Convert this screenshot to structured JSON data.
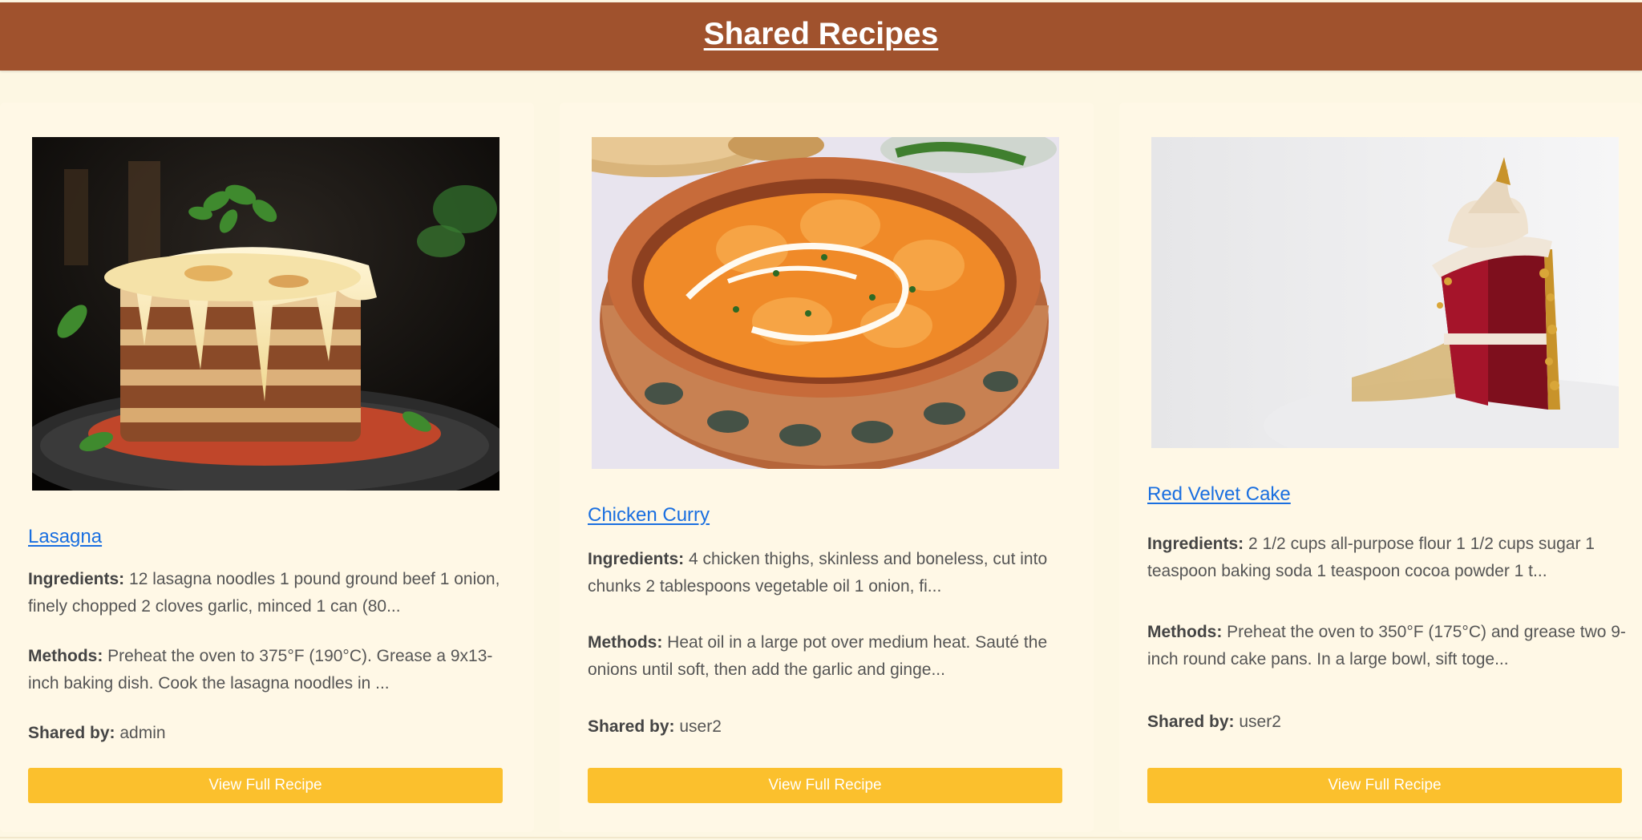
{
  "header": {
    "title": "Shared Recipes"
  },
  "colors": {
    "header_bg": "#a0522d",
    "page_bg": "#fdf7e3",
    "card_bg": "#fff8e6",
    "button_bg": "#fbc02d",
    "link": "#1a6fe0"
  },
  "labels": {
    "ingredients": "Ingredients:",
    "methods": "Methods:",
    "shared_by": "Shared by:"
  },
  "recipes": [
    {
      "title": "Lasagna",
      "image_alt": "Lasagna",
      "ingredients": "12 lasagna noodles 1 pound ground beef 1 onion, finely chopped 2 cloves garlic, minced 1 can (80...",
      "methods": "Preheat the oven to 375°F (190°C). Grease a 9x13-inch baking dish. Cook the lasagna noodles in ...",
      "shared_by": "admin",
      "button": "View Full Recipe"
    },
    {
      "title": "Chicken Curry",
      "image_alt": "Chicken Curry",
      "ingredients": "4 chicken thighs, skinless and boneless, cut into chunks 2 tablespoons vegetable oil 1 onion, fi...",
      "methods": "Heat oil in a large pot over medium heat. Sauté the onions until soft, then add the garlic and ginge...",
      "shared_by": "user2",
      "button": "View Full Recipe"
    },
    {
      "title": "Red Velvet Cake",
      "image_alt": "Red Velvet Cake",
      "ingredients": "2 1/2 cups all-purpose flour 1 1/2 cups sugar 1 teaspoon baking soda 1 teaspoon cocoa powder 1 t...",
      "methods": "Preheat the oven to 350°F (175°C) and grease two 9-inch round cake pans. In a large bowl, sift toge...",
      "shared_by": "user2",
      "button": "View Full Recipe"
    }
  ]
}
